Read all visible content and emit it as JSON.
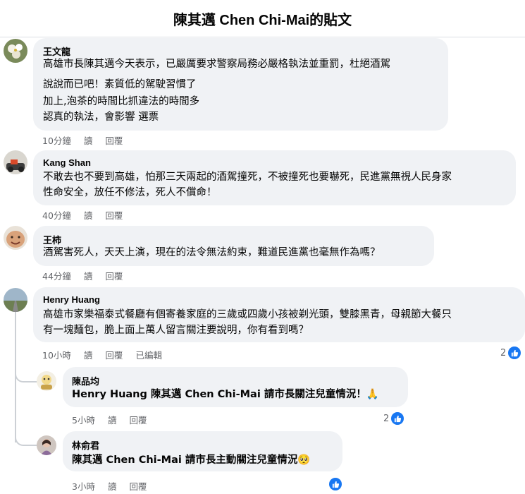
{
  "header": {
    "title": "陳其邁 Chen Chi-Mai的貼文"
  },
  "comments": [
    {
      "author": "王文龍",
      "lines": [
        "高雄市長陳其邁今天表示，已嚴厲要求警察局務必嚴格執法並重罰，杜絕酒駕",
        "說說而已吧！素質低的駕駛習慣了",
        "加上,泡茶的時間比抓違法的時間多",
        "認真的執法，會影響 選票"
      ],
      "time": "10分鐘",
      "read": "讀",
      "reply": "回覆"
    },
    {
      "author": "Kang Shan",
      "lines": [
        "不敢去也不要到高雄，怕那三天兩起的酒駕撞死，不被撞死也要嚇死，民進黨無視人民身家",
        "性命安全，放任不修法，死人不償命！"
      ],
      "time": "40分鐘",
      "read": "讀",
      "reply": "回覆"
    },
    {
      "author": "王柿",
      "lines": [
        "酒駕害死人，天天上演，現在的法令無法約束，難道民進黨也毫無作為嗎？"
      ],
      "time": "44分鐘",
      "read": "讀",
      "reply": "回覆"
    },
    {
      "author": "Henry Huang",
      "lines": [
        "高雄市家樂福泰式餐廳有個寄養家庭的三歲或四歲小孩被剃光頭，雙膝黑青，母親節大餐只",
        "有一塊麵包，脆上面上萬人留言關注要說明，你有看到嗎？"
      ],
      "time": "10小時",
      "read": "讀",
      "reply": "回覆",
      "edited": "已編輯",
      "reactions": "2"
    }
  ],
  "replies": [
    {
      "author": "陳品均",
      "text": "Henry Huang 陳其邁 Chen Chi-Mai 請市長關注兒童情況！🙏",
      "time": "5小時",
      "read": "讀",
      "reply": "回覆",
      "reactions": "2"
    },
    {
      "author": "林俞君",
      "text": "陳其邁 Chen Chi-Mai 請市長主動關注兒童情況🥺",
      "time": "3小時",
      "read": "讀",
      "reply": "回覆",
      "reactions": ""
    }
  ],
  "icons": {
    "like": "thumbs-up-icon",
    "accent": "#1877f2"
  }
}
